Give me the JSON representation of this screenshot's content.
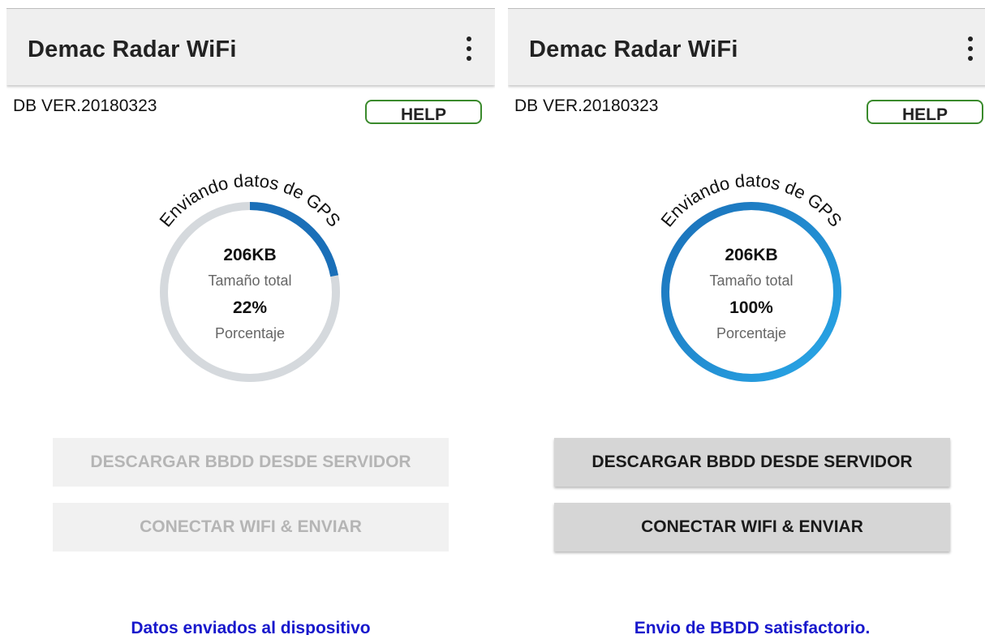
{
  "screens": [
    {
      "app_title": "Demac Radar WiFi",
      "db_version": "DB VER.20180323",
      "help_label": "HELP",
      "gauge": {
        "arc_label": "Enviando datos de GPS",
        "size_value": "206KB",
        "size_label": "Tamaño total",
        "percent_text": "22%",
        "percent_label": "Porcentaje",
        "progress": 0.22
      },
      "download_button": "DESCARGAR BBDD DESDE SERVIDOR",
      "connect_button": "CONECTAR WIFI & ENVIAR",
      "buttons_enabled": false,
      "status_message": "Datos enviados al dispositivo"
    },
    {
      "app_title": "Demac Radar WiFi",
      "db_version": "DB VER.20180323",
      "help_label": "HELP",
      "gauge": {
        "arc_label": "Enviando datos de GPS",
        "size_value": "206KB",
        "size_label": "Tamaño total",
        "percent_text": "100%",
        "percent_label": "Porcentaje",
        "progress": 1.0
      },
      "download_button": "DESCARGAR BBDD DESDE SERVIDOR",
      "connect_button": "CONECTAR WIFI & ENVIAR",
      "buttons_enabled": true,
      "status_message": "Envio de BBDD satisfactorio."
    }
  ],
  "colors": {
    "progress_blue": "#1a6fb8",
    "progress_light_blue": "#29a8e8",
    "track_gray": "#d5d9dd",
    "help_border_green": "#3a8a2c",
    "status_blue": "#1818cc"
  },
  "icons": {
    "menu": "more-vert-icon"
  }
}
